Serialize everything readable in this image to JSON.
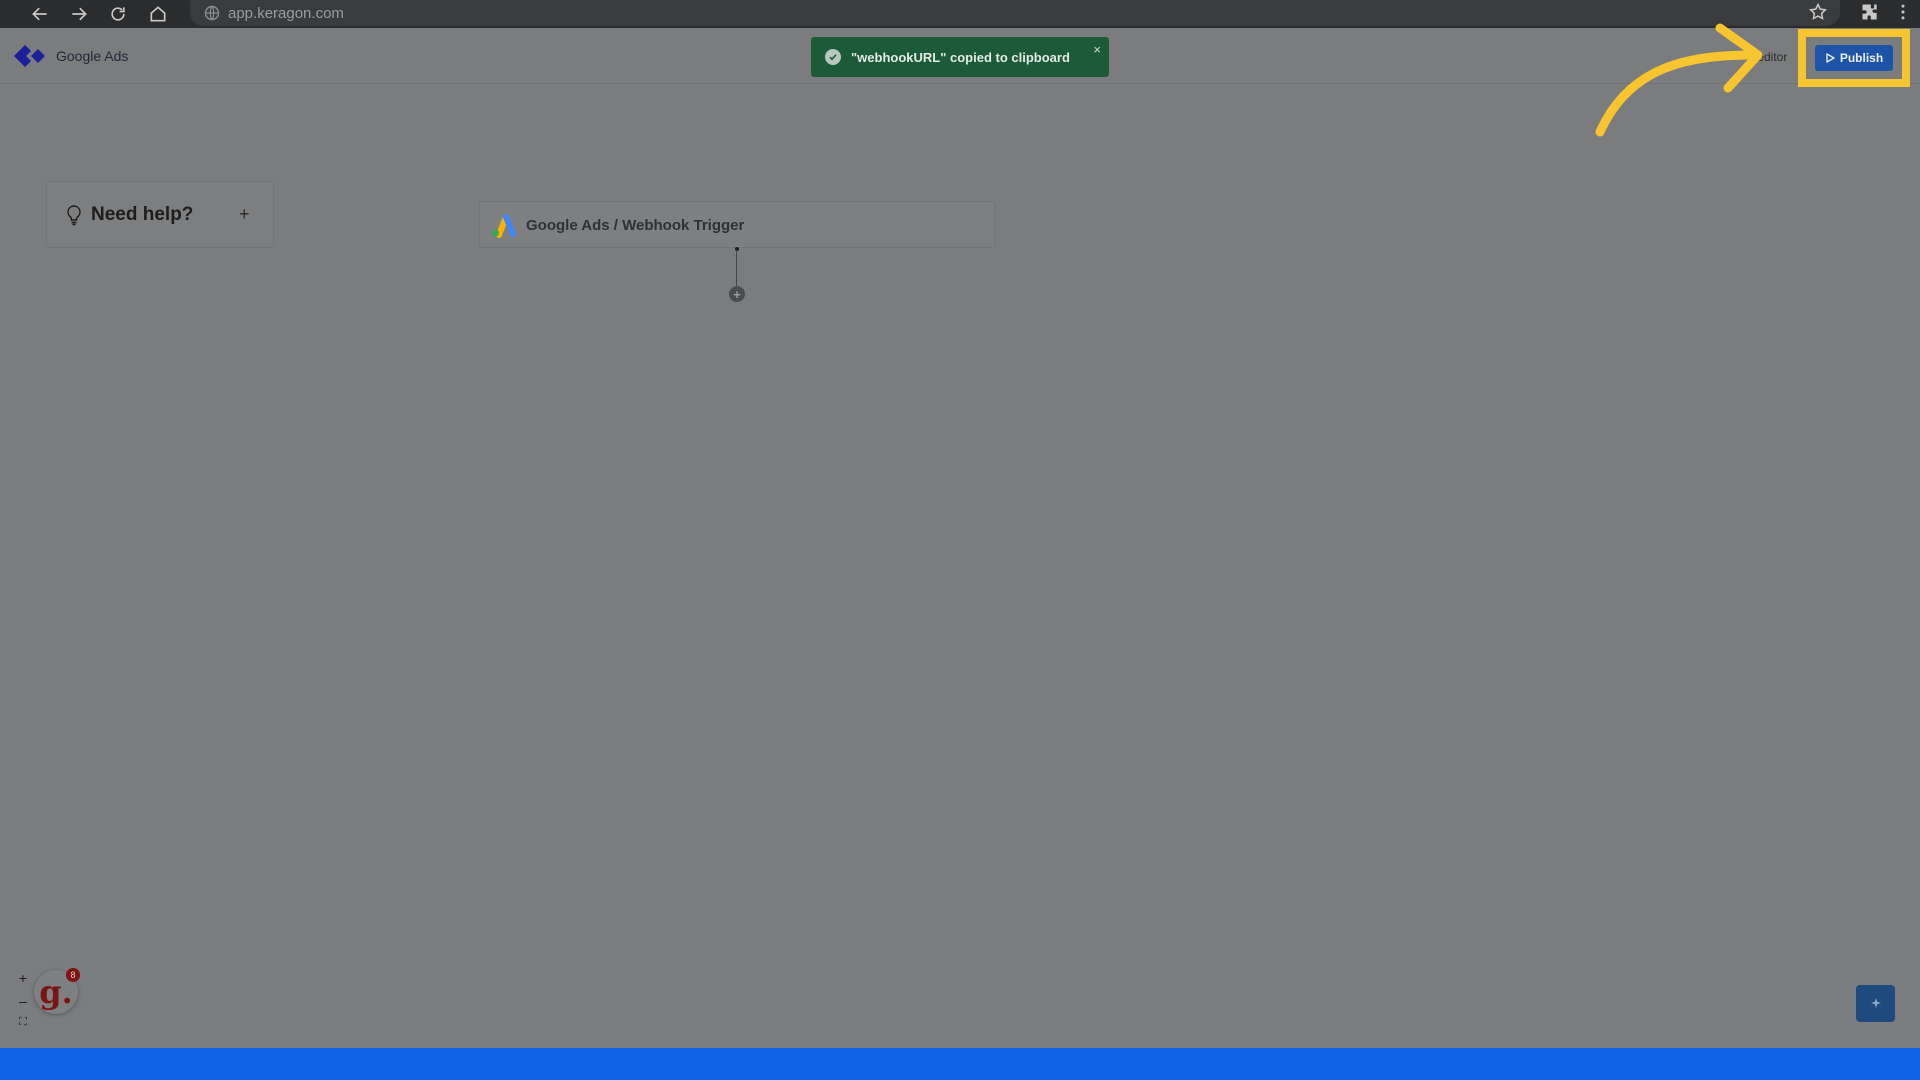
{
  "browser": {
    "url": "app.keragon.com"
  },
  "header": {
    "app_name": "Google Ads",
    "edit_editor_label": "it editor",
    "publish_label": "Publish"
  },
  "toast": {
    "message": "\"webhookURL\" copied to clipboard",
    "close_glyph": "×"
  },
  "help_card": {
    "title": "Need help?",
    "plus_glyph": "+"
  },
  "trigger_card": {
    "title": "Google Ads / Webhook Trigger"
  },
  "canvas": {
    "add_step_glyph": "+"
  },
  "zoom": {
    "zoom_in": "+",
    "zoom_out": "–",
    "fit": "⛶"
  },
  "badge": {
    "letter": "g.",
    "count": "8"
  },
  "colors": {
    "publish": "#1e54a8",
    "highlight": "#f7c530",
    "toast": "#1d5a37",
    "footer": "#0f64e6"
  }
}
